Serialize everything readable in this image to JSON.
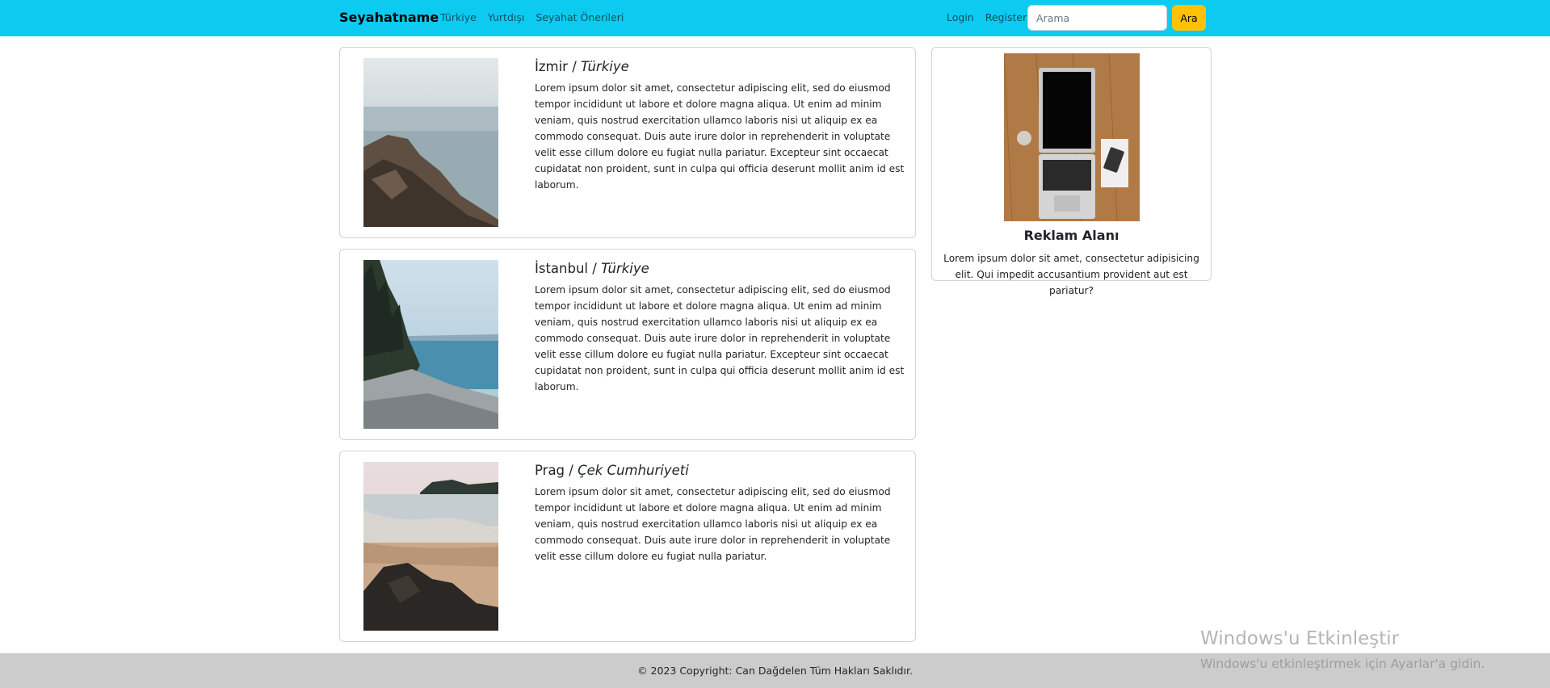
{
  "navbar": {
    "brand": "Seyahatname",
    "links": [
      "Türkiye",
      "Yurtdışı",
      "Seyahat Önerileri"
    ],
    "login": "Login",
    "register": "Register",
    "search_placeholder": "Arama",
    "search_button": "Ara",
    "bg_color": "#0dcaf0",
    "button_color": "#ffc107"
  },
  "posts": [
    {
      "city": "İzmir / ",
      "country": "Türkiye",
      "text": "Lorem ipsum dolor sit amet, consectetur adipiscing elit, sed do eiusmod tempor incididunt ut labore et dolore magna aliqua. Ut enim ad minim veniam, quis nostrud exercitation ullamco laboris nisi ut aliquip ex ea commodo consequat. Duis aute irure dolor in reprehenderit in voluptate velit esse cillum dolore eu fugiat nulla pariatur. Excepteur sint occaecat cupidatat non proident, sunt in culpa qui officia deserunt mollit anim id est laborum."
    },
    {
      "city": "İstanbul / ",
      "country": "Türkiye",
      "text": "Lorem ipsum dolor sit amet, consectetur adipiscing elit, sed do eiusmod tempor incididunt ut labore et dolore magna aliqua. Ut enim ad minim veniam, quis nostrud exercitation ullamco laboris nisi ut aliquip ex ea commodo consequat. Duis aute irure dolor in reprehenderit in voluptate velit esse cillum dolore eu fugiat nulla pariatur. Excepteur sint occaecat cupidatat non proident, sunt in culpa qui officia deserunt mollit anim id est laborum."
    },
    {
      "city": "Prag / ",
      "country": "Çek Cumhuriyeti",
      "text": "Lorem ipsum dolor sit amet, consectetur adipiscing elit, sed do eiusmod tempor incididunt ut labore et dolore magna aliqua. Ut enim ad minim veniam, quis nostrud exercitation ullamco laboris nisi ut aliquip ex ea commodo consequat. Duis aute irure dolor in reprehenderit in voluptate velit esse cillum dolore eu fugiat nulla pariatur."
    }
  ],
  "ad": {
    "title": "Reklam Alanı",
    "text": "Lorem ipsum dolor sit amet, consectetur adipisicing elit. Qui impedit accusantium provident aut est pariatur?"
  },
  "footer": {
    "text": "© 2023 Copyright: Can Dağdelen Tüm Hakları Saklıdır."
  },
  "watermark": {
    "title": "Windows'u Etkinleştir",
    "subtitle": "Windows'u etkinleştirmek için Ayarlar'a gidin."
  }
}
